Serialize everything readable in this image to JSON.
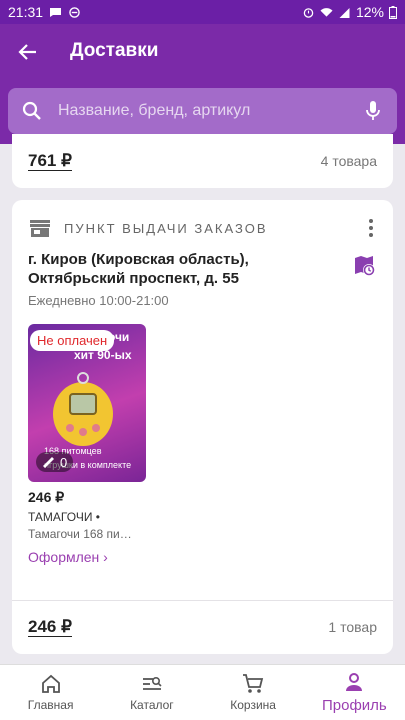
{
  "status_bar": {
    "time": "21:31",
    "battery": "12%"
  },
  "header": {
    "title": "Доставки",
    "search_placeholder": "Название, бренд, артикул"
  },
  "prev_order": {
    "amount": "761 ₽",
    "count": "4 товара"
  },
  "order": {
    "pickup_label": "ПУНКТ ВЫДАЧИ ЗАКАЗОВ",
    "address": "г. Киров (Кировская область), Октябрьский проспект, д. 55",
    "hours": "Ежедневно 10:00-21:00",
    "item": {
      "badge": "Не оплачен",
      "promo_line1": "Тамагочи",
      "promo_line2": "хит 90-ых",
      "promo_line3": "168 питомцев",
      "promo_line4": "игрушки в комплекте",
      "qty": "0",
      "price": "246 ₽",
      "name": "ТАМАГОЧИ •",
      "subtitle": "Тамагочи 168 пи…",
      "status": "Оформлен ›"
    },
    "total_amount": "246 ₽",
    "total_count": "1 товар"
  },
  "nav": {
    "items": [
      {
        "label": "Главная",
        "icon": "home-icon"
      },
      {
        "label": "Каталог",
        "icon": "catalog-icon"
      },
      {
        "label": "Корзина",
        "icon": "cart-icon"
      },
      {
        "label": "Профиль",
        "icon": "profile-icon"
      }
    ],
    "active": "Профиль"
  },
  "colors": {
    "brand": "#7b2aa8",
    "accent": "#9a3fb0",
    "alert": "#e0282c"
  }
}
